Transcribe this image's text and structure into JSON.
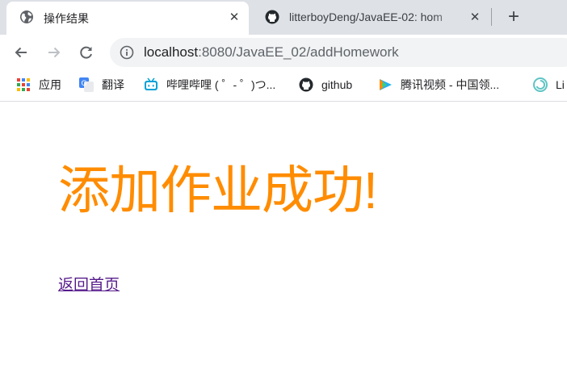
{
  "browser": {
    "tabs": [
      {
        "title": "操作结果",
        "icon": "globe-icon",
        "active": true
      },
      {
        "title": "litterboyDeng/JavaEE-02: hom",
        "icon": "github-icon",
        "active": false
      }
    ],
    "new_tab_icon": "plus-icon",
    "close_icon": "close-icon"
  },
  "toolbar": {
    "back_icon": "arrow-left-icon",
    "forward_icon": "arrow-right-icon",
    "reload_icon": "reload-icon",
    "info_icon": "info-icon",
    "url_host": "localhost",
    "url_path": ":8080/JavaEE_02/addHomework"
  },
  "bookmarks": [
    {
      "label": "应用",
      "icon": "apps-grid-icon"
    },
    {
      "label": "翻译",
      "icon": "translate-icon"
    },
    {
      "label": "哔哩哔哩 ( ゜- ゜)つ...",
      "icon": "bilibili-icon"
    },
    {
      "label": "github",
      "icon": "github-icon"
    },
    {
      "label": "腾讯视频 - 中国领...",
      "icon": "tencent-video-icon"
    },
    {
      "label": "Li",
      "icon": "swirl-icon"
    }
  ],
  "page": {
    "heading": "添加作业成功!",
    "home_link": "返回首页"
  },
  "colors": {
    "heading": "#ff8c00",
    "link_visited": "#551a8b",
    "tabstrip": "#dee1e6",
    "omnibox": "#f1f3f4"
  }
}
